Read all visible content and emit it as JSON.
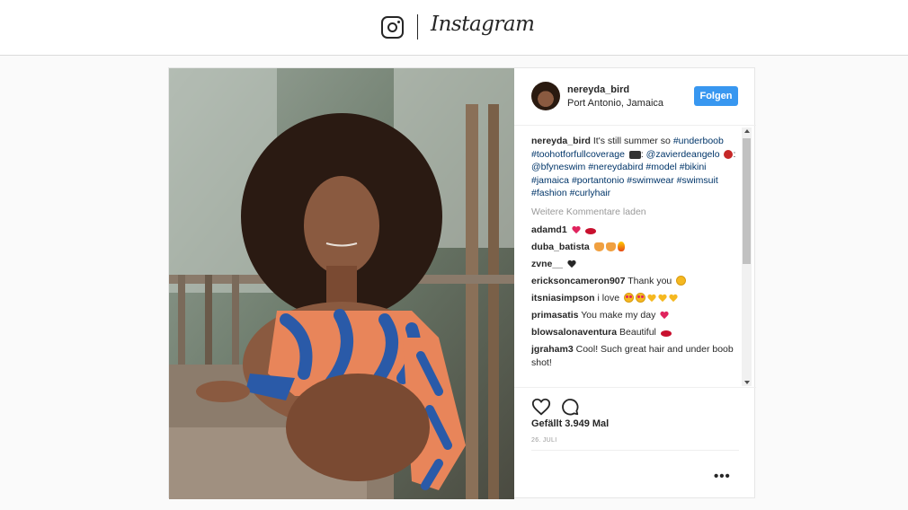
{
  "header": {
    "brand": "Instagram"
  },
  "post": {
    "username": "nereyda_bird",
    "location": "Port Antonio, Jamaica",
    "follow_label": "Folgen",
    "caption": {
      "user": "nereyda_bird",
      "text_1": " It's still summer so ",
      "tags_1": "#underboob #toohotforfullcoverage",
      "text_2": ": ",
      "mention_1": "@zavierdeangelo",
      "text_3": ": ",
      "mention_2": "@bfyneswim",
      "tags_2": "#nereydabird #model #bikini #jamaica #portantonio #swimwear #swimsuit #fashion #curlyhair"
    },
    "load_more": "Weitere Kommentare laden",
    "comments": [
      {
        "user": "adamd1",
        "text": ""
      },
      {
        "user": "duba_batista",
        "text": ""
      },
      {
        "user": "zvne__",
        "text": ""
      },
      {
        "user": "ericksoncameron907",
        "text": "Thank you"
      },
      {
        "user": "itsniasimpson",
        "text": "i love"
      },
      {
        "user": "primasatis",
        "text": "You make my day"
      },
      {
        "user": "blowsalonaventura",
        "text": "Beautiful"
      },
      {
        "user": "jgraham3",
        "text": "Cool! Such great hair and under boob shot!"
      }
    ],
    "likes": "Gefällt 3.949 Mal",
    "date": "26. JULI",
    "more": "•••"
  },
  "icons": {
    "logo": "instagram-camera-icon",
    "like": "heart-outline-icon",
    "comment": "speech-bubble-icon",
    "more": "ellipsis-icon"
  },
  "colors": {
    "accent": "#3897f0",
    "hashtag": "#003569",
    "muted": "#999999"
  }
}
